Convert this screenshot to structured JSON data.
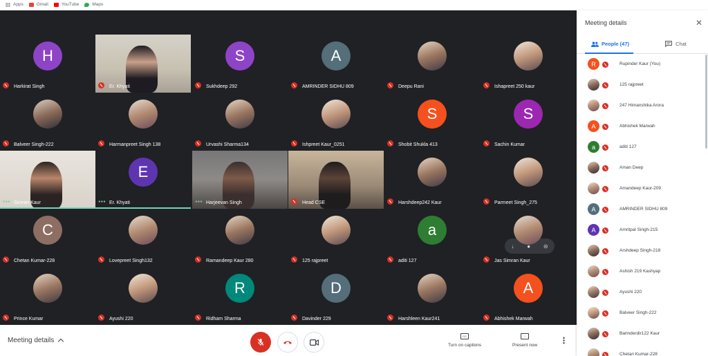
{
  "bookmarks": [
    {
      "label": "Apps",
      "icon": "apps-grid-icon"
    },
    {
      "label": "Gmail",
      "icon": "gmail-icon"
    },
    {
      "label": "YouTube",
      "icon": "youtube-icon"
    },
    {
      "label": "Maps",
      "icon": "maps-icon"
    }
  ],
  "colors": {
    "stage_bg": "#202124",
    "muted_mic": "#d93025",
    "accent_blue": "#1a73e8",
    "speaking": "#81c995"
  },
  "tiles": [
    {
      "name": "Harkirat Singh",
      "initial": "H",
      "color": "#8e44c7",
      "kind": "avatar"
    },
    {
      "name": "Er. Khyati",
      "kind": "video",
      "video": "v1"
    },
    {
      "name": "Sukhdeep 292",
      "initial": "S",
      "color": "#8e44c7",
      "kind": "avatar"
    },
    {
      "name": "AMRINDER SIDHU 809",
      "initial": "A",
      "color": "#546e7a",
      "kind": "avatar"
    },
    {
      "name": "Deepu Rani",
      "kind": "photo"
    },
    {
      "name": "Ishapreet 250 kaur",
      "kind": "photo"
    },
    {
      "name": "Balveer Singh-222",
      "kind": "photo"
    },
    {
      "name": "Harmanpreet Singh 138",
      "kind": "photo"
    },
    {
      "name": "Urvashi Sharma134",
      "kind": "photo"
    },
    {
      "name": "Ishpreet Kaur_0251",
      "kind": "photo"
    },
    {
      "name": "Shobit Shukla 413",
      "initial": "S",
      "color": "#f4511e",
      "kind": "avatar"
    },
    {
      "name": "Sachin Kumar",
      "initial": "S",
      "color": "#9c27b0",
      "kind": "avatar"
    },
    {
      "name": "Simran Kaur",
      "kind": "video",
      "video": "v2",
      "speaking": true
    },
    {
      "name": "Er. Khyati",
      "initial": "E",
      "color": "#5e35b1",
      "kind": "avatar",
      "speaking": true
    },
    {
      "name": "Harjeevan Singh",
      "kind": "video",
      "video": "v3",
      "speaking": true
    },
    {
      "name": "Head CSE",
      "kind": "video",
      "video": "v4"
    },
    {
      "name": "Harshdeep242 Kaur",
      "kind": "photo"
    },
    {
      "name": "Parmeet Singh_275",
      "kind": "photo"
    },
    {
      "name": "Chetan Kumar-228",
      "initial": "C",
      "color": "#8d6e63",
      "kind": "avatar"
    },
    {
      "name": "Lovepreet Singh132",
      "kind": "photo"
    },
    {
      "name": "Ramandeep Kaur 280",
      "kind": "photo"
    },
    {
      "name": "125 rajpreet",
      "kind": "photo"
    },
    {
      "name": "aditi 127",
      "initial": "a",
      "color": "#2e7d32",
      "kind": "avatar"
    },
    {
      "name": "Jas Simran Kaur",
      "kind": "photo"
    },
    {
      "name": "Prince Kumar",
      "kind": "photo"
    },
    {
      "name": "Ayushi 220",
      "kind": "photo"
    },
    {
      "name": "Ridham Sharma",
      "initial": "R",
      "color": "#00897b",
      "kind": "avatar"
    },
    {
      "name": "Davinder 229",
      "initial": "D",
      "color": "#546e7a",
      "kind": "avatar"
    },
    {
      "name": "Harshleen Kaur241",
      "kind": "photo"
    },
    {
      "name": "Abhishek Marwah",
      "initial": "A",
      "color": "#f4511e",
      "kind": "avatar"
    }
  ],
  "bottom": {
    "meeting_details": "Meeting details",
    "captions_label": "Turn on captions",
    "captions_icon": "CC",
    "present_label": "Present now"
  },
  "panel": {
    "title": "Meeting details",
    "people_tab": "People (47)",
    "chat_tab": "Chat",
    "people": [
      {
        "name": "Rupinder Kaur (You)",
        "initial": "R",
        "color": "#f4511e",
        "kind": "avatar"
      },
      {
        "name": "125 rajpreet",
        "kind": "photo"
      },
      {
        "name": "247 Himanshika Arora",
        "kind": "photo"
      },
      {
        "name": "Abhishek Marwah",
        "initial": "A",
        "color": "#f4511e",
        "kind": "avatar"
      },
      {
        "name": "aditi 127",
        "initial": "a",
        "color": "#2e7d32",
        "kind": "avatar"
      },
      {
        "name": "Aman Deep",
        "kind": "photo"
      },
      {
        "name": "Amandeep Kaur-209",
        "kind": "photo"
      },
      {
        "name": "AMRINDER SIDHU 809",
        "initial": "A",
        "color": "#546e7a",
        "kind": "avatar"
      },
      {
        "name": "Amritpal Singh-215",
        "initial": "A",
        "color": "#5e35b1",
        "kind": "avatar"
      },
      {
        "name": "Arshdeep Singh-218",
        "kind": "photo"
      },
      {
        "name": "Ashish 219 Kashyap",
        "kind": "photo"
      },
      {
        "name": "Ayushi 220",
        "kind": "photo"
      },
      {
        "name": "Balveer Singh-222",
        "kind": "photo"
      },
      {
        "name": "Barinderdir122 Kaur",
        "kind": "photo"
      },
      {
        "name": "Chetan Kumar-228",
        "kind": "photo"
      }
    ]
  }
}
